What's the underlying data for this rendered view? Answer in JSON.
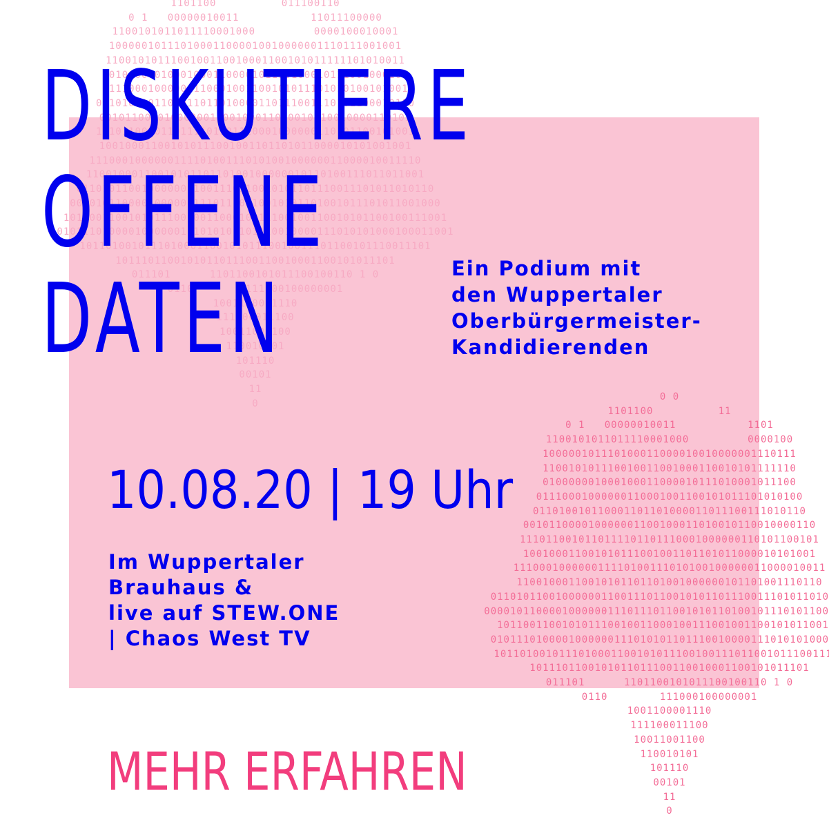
{
  "headline": {
    "lines": [
      "DISKUTIERE",
      "OFFENE",
      "DATEN"
    ]
  },
  "subtitle": {
    "lines": [
      "Ein Podium mit",
      "den Wuppertaler",
      "Oberbürgermeister-",
      "Kandidierenden"
    ]
  },
  "event": {
    "datetime": "10.08.20 | 19 Uhr",
    "location_lines": [
      "Im Wuppertaler",
      "Brauhaus &",
      "live auf STEW.ONE",
      "| Chaos West TV"
    ]
  },
  "cta": {
    "label": "MEHR ERFAHREN"
  },
  "decoration": {
    "binary_map_top": "1101100          011100110\n0 1   00000010011           11011100000\n1100101011011110001000         0000100010001\n100000101110100011000010010000001110111001001\n1100101011100100110010001100101011111101010011\n010000001000100011000010111010001011100100010\n01110001000000110001001100101011101010100101001\n0110100101100011011010000110111001110101100010100\n001011000010000001100100011010010110010000110101\n1110110010110111101101110001000000110101100101001\n100100011001010111001001101101011000010101001001\n111000100000011110100111010100100000011000010011110\n1100100011001010110110100100000010110100111011011001\n0110101100100000011001110110010101101110011101011010110\n000010110000100000011101110110010101101001011101011001000\n10110011001010111001001100010011100100110010101100100111001\n0101110100001000000111010101101110010000111010101000100011001\n101101001011101000110010101110010011101100101110011101\n1011101100101011011100110010001100101011101\n011101      1101100101011100100110 1 0\n0110        111000100000001\n1001100001110\n111100011100\n10011001100\n110010101\n101110\n00101\n11\n0",
    "binary_map_bottom": "0 0\n1101100          11\n0 1   00000010011           1101\n1100101011011110001000         0000100\n100000101110100011000010010000001110111\n110010101110010011001000110010101111110\n010000001000100011000010111010001011100\n01110001000000110001001100101011101010100\n011010010110001101101000011011100111010110\n001011000010000001100100011010010110010000110\n1110110010110111101101110001000000110101100101\n100100011001010111001001101101011000010101001\n111000100000011110100111010100100000011000010011\n11001000110010101101101001000000101101001110110\n0110101100100000011001110110010101101110011101011010110\n000010110000100000011101110110010101101001011101011001000\n10110011001010111001001100010011100100110010101100100\n0101110100001000000111010101101110010000111010101000100\n101101001011101000110010101110010011101100101110011101\n1011101100101011011100110010001100101011101\n011101      1101100101011100100110 1 0\n0110        111000100000001\n1001100001110\n111100011100\n10011001100\n110010101\n101110\n00101\n11\n0"
  },
  "colors": {
    "blue": "#0000ee",
    "pink_box": "#fac4d4",
    "binary_pink": "#f36d97",
    "cta_pink": "#f23d7d"
  }
}
